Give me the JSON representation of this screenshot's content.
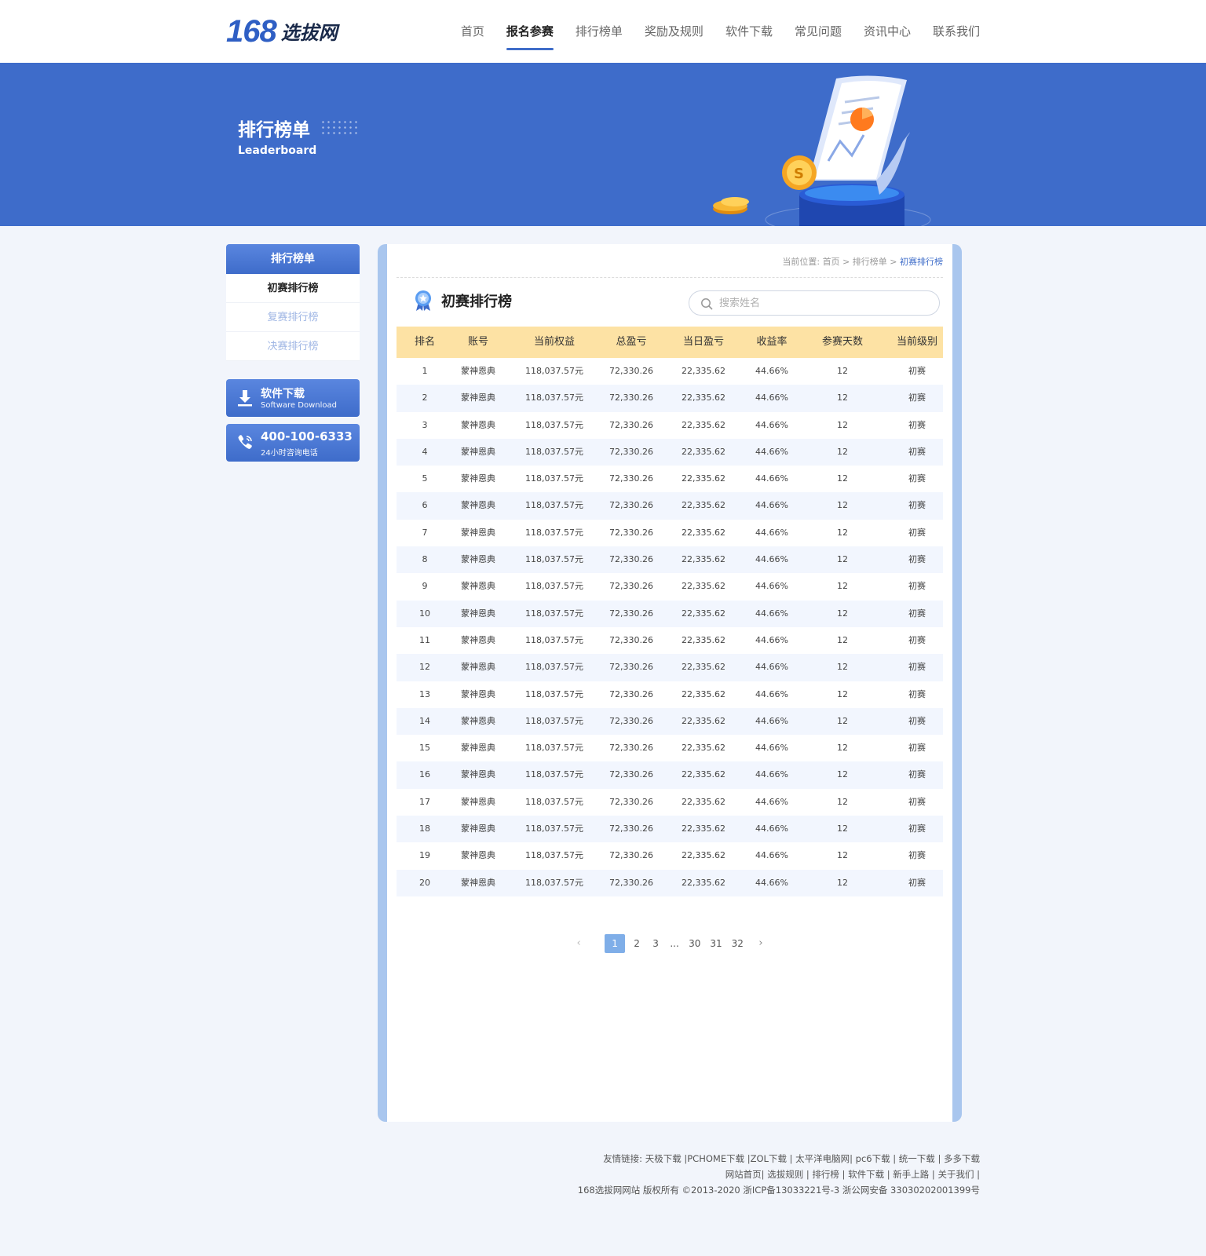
{
  "header": {
    "logo_number": "168",
    "logo_text": "选拔网",
    "nav": [
      "首页",
      "报名参赛",
      "排行榜单",
      "奖励及规则",
      "软件下载",
      "常见问题",
      "资讯中心",
      "联系我们"
    ],
    "nav_active_index": 1
  },
  "banner": {
    "title": "排行榜单",
    "subtitle": "Leaderboard"
  },
  "sidebar": {
    "heading": "排行榜单",
    "items": [
      "初赛排行榜",
      "复赛排行榜",
      "决赛排行榜"
    ],
    "download": {
      "title": "软件下载",
      "subtitle": "Software Download",
      "icon": "download-icon"
    },
    "phone": {
      "number": "400-100-6333",
      "subtitle": "24小时咨询电话",
      "icon": "phone-icon"
    }
  },
  "main": {
    "breadcrumb": {
      "label": "当前位置:",
      "items": [
        "首页",
        "排行榜单"
      ],
      "current": "初赛排行榜",
      "separator": ">"
    },
    "section_title": "初赛排行榜",
    "search": {
      "placeholder": "搜索姓名",
      "value": ""
    },
    "table": {
      "headers": [
        "排名",
        "账号",
        "当前权益",
        "总盈亏",
        "当日盈亏",
        "收益率",
        "参赛天数",
        "当前级别"
      ],
      "rows": [
        [
          "1",
          "蒙神恩典",
          "118,037.57元",
          "72,330.26",
          "22,335.62",
          "44.66%",
          "12",
          "初赛"
        ],
        [
          "2",
          "蒙神恩典",
          "118,037.57元",
          "72,330.26",
          "22,335.62",
          "44.66%",
          "12",
          "初赛"
        ],
        [
          "3",
          "蒙神恩典",
          "118,037.57元",
          "72,330.26",
          "22,335.62",
          "44.66%",
          "12",
          "初赛"
        ],
        [
          "4",
          "蒙神恩典",
          "118,037.57元",
          "72,330.26",
          "22,335.62",
          "44.66%",
          "12",
          "初赛"
        ],
        [
          "5",
          "蒙神恩典",
          "118,037.57元",
          "72,330.26",
          "22,335.62",
          "44.66%",
          "12",
          "初赛"
        ],
        [
          "6",
          "蒙神恩典",
          "118,037.57元",
          "72,330.26",
          "22,335.62",
          "44.66%",
          "12",
          "初赛"
        ],
        [
          "7",
          "蒙神恩典",
          "118,037.57元",
          "72,330.26",
          "22,335.62",
          "44.66%",
          "12",
          "初赛"
        ],
        [
          "8",
          "蒙神恩典",
          "118,037.57元",
          "72,330.26",
          "22,335.62",
          "44.66%",
          "12",
          "初赛"
        ],
        [
          "9",
          "蒙神恩典",
          "118,037.57元",
          "72,330.26",
          "22,335.62",
          "44.66%",
          "12",
          "初赛"
        ],
        [
          "10",
          "蒙神恩典",
          "118,037.57元",
          "72,330.26",
          "22,335.62",
          "44.66%",
          "12",
          "初赛"
        ],
        [
          "11",
          "蒙神恩典",
          "118,037.57元",
          "72,330.26",
          "22,335.62",
          "44.66%",
          "12",
          "初赛"
        ],
        [
          "12",
          "蒙神恩典",
          "118,037.57元",
          "72,330.26",
          "22,335.62",
          "44.66%",
          "12",
          "初赛"
        ],
        [
          "13",
          "蒙神恩典",
          "118,037.57元",
          "72,330.26",
          "22,335.62",
          "44.66%",
          "12",
          "初赛"
        ],
        [
          "14",
          "蒙神恩典",
          "118,037.57元",
          "72,330.26",
          "22,335.62",
          "44.66%",
          "12",
          "初赛"
        ],
        [
          "15",
          "蒙神恩典",
          "118,037.57元",
          "72,330.26",
          "22,335.62",
          "44.66%",
          "12",
          "初赛"
        ],
        [
          "16",
          "蒙神恩典",
          "118,037.57元",
          "72,330.26",
          "22,335.62",
          "44.66%",
          "12",
          "初赛"
        ],
        [
          "17",
          "蒙神恩典",
          "118,037.57元",
          "72,330.26",
          "22,335.62",
          "44.66%",
          "12",
          "初赛"
        ],
        [
          "18",
          "蒙神恩典",
          "118,037.57元",
          "72,330.26",
          "22,335.62",
          "44.66%",
          "12",
          "初赛"
        ],
        [
          "19",
          "蒙神恩典",
          "118,037.57元",
          "72,330.26",
          "22,335.62",
          "44.66%",
          "12",
          "初赛"
        ],
        [
          "20",
          "蒙神恩典",
          "118,037.57元",
          "72,330.26",
          "22,335.62",
          "44.66%",
          "12",
          "初赛"
        ]
      ]
    },
    "pagination": {
      "prev": "‹",
      "next": "›",
      "pages": [
        "1",
        "2",
        "3",
        "...",
        "30",
        "31",
        "32"
      ],
      "current": "1"
    }
  },
  "footer": {
    "lines": [
      "友情链接: 天极下载 |PCHOME下载 |ZOL下载 | 太平洋电脑网| pc6下载 | 统一下载 | 多多下载",
      "网站首页| 选拔规则 | 排行榜 | 软件下载 | 新手上路 | 关于我们 |",
      "168选拔网网站 版权所有 ©2013-2020 浙ICP备13033221号-3 浙公网安备 33030202001399号"
    ]
  },
  "colors": {
    "brand": "#3e6cca",
    "table_header": "#fde2a4",
    "row_alt": "#f2f6fe",
    "page_active": "#7faee8"
  }
}
